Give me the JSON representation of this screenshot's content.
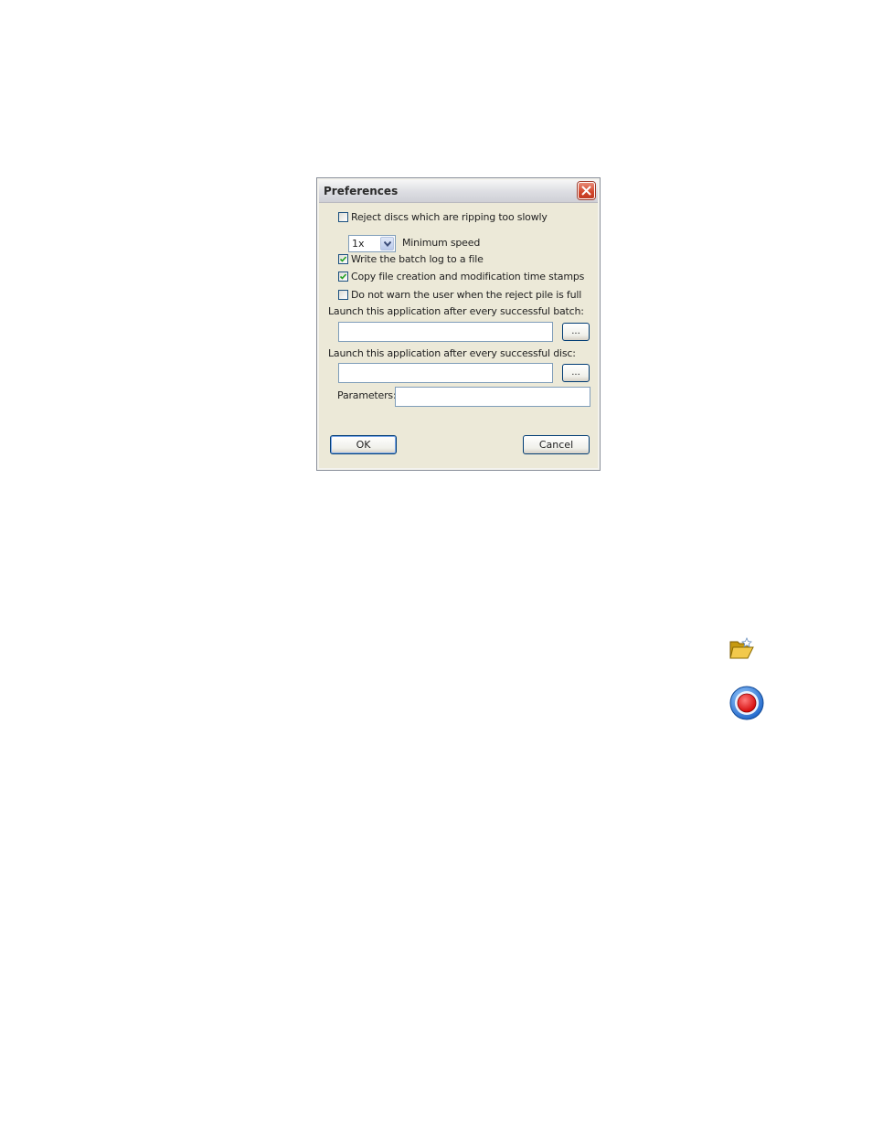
{
  "dialog": {
    "title": "Preferences",
    "options": [
      {
        "label": "Reject discs which are ripping too slowly",
        "checked": false
      },
      {
        "label": "Write the batch log to a file",
        "checked": true
      },
      {
        "label": "Copy file creation and modification time stamps",
        "checked": true
      },
      {
        "label": "Do not warn the user when the reject pile is full",
        "checked": false
      }
    ],
    "min_speed": {
      "value": "1x",
      "label": "Minimum speed"
    },
    "batch_app": {
      "label": "Launch this application after every successful batch:",
      "value": "",
      "browse_label": "..."
    },
    "disc_app": {
      "label": "Launch this application after every successful disc:",
      "value": "",
      "browse_label": "..."
    },
    "parameters": {
      "label": "Parameters:",
      "value": ""
    },
    "ok_label": "OK",
    "cancel_label": "Cancel"
  },
  "side_icons": [
    "open-folder-icon",
    "record-icon"
  ],
  "colors": {
    "accent": "#003c74",
    "close": "#d2452a",
    "record_red": "#e00000",
    "record_blue": "#2a7de0"
  }
}
